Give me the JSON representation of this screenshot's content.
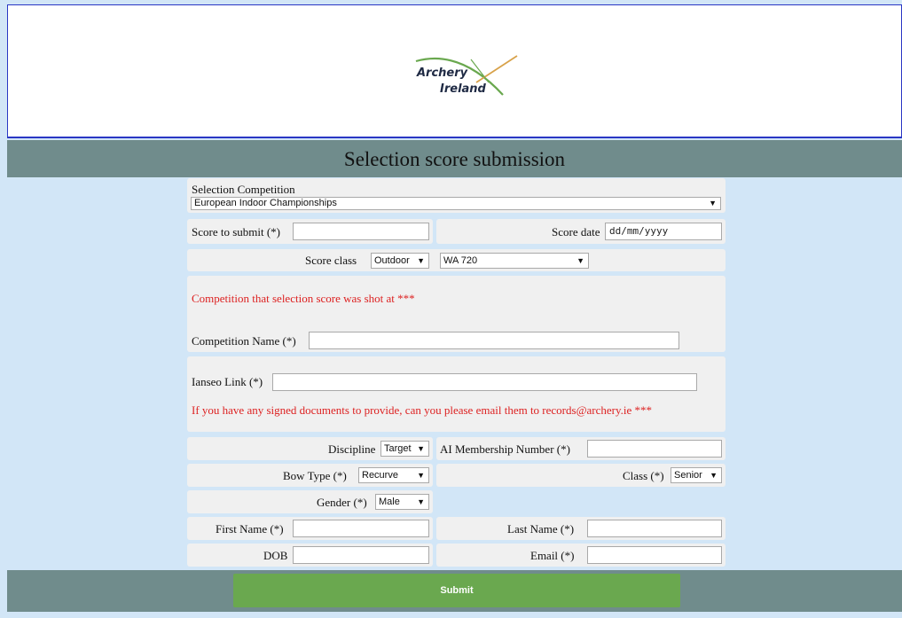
{
  "header": {
    "logo_line1": "Archery",
    "logo_line2": "Ireland"
  },
  "page_title": "Selection score submission",
  "form": {
    "selection_competition": {
      "label": "Selection Competition",
      "value": "European Indoor Championships"
    },
    "score_to_submit": {
      "label": "Score to submit (*)",
      "value": ""
    },
    "score_date": {
      "label": "Score date",
      "placeholder": "dd/mm/yyyy"
    },
    "score_class": {
      "label": "Score class",
      "value": "Outdoor",
      "round_value": "WA 720"
    },
    "competition_note": "Competition that selection score was shot at ***",
    "competition_name": {
      "label": "Competition Name (*)",
      "value": ""
    },
    "ianseo_link": {
      "label": "Ianseo Link (*)",
      "value": ""
    },
    "documents_note": "If you have any signed documents to provide, can you please email them to records@archery.ie ***",
    "discipline": {
      "label": "Discipline",
      "value": "Target"
    },
    "membership_number": {
      "label": "AI Membership Number (*)",
      "value": ""
    },
    "bow_type": {
      "label": "Bow Type (*)",
      "value": "Recurve"
    },
    "class": {
      "label": "Class (*)",
      "value": "Senior"
    },
    "gender": {
      "label": "Gender (*)",
      "value": "Male"
    },
    "first_name": {
      "label": "First Name (*)",
      "value": ""
    },
    "last_name": {
      "label": "Last Name (*)",
      "value": ""
    },
    "dob": {
      "label": "DOB",
      "value": ""
    },
    "email": {
      "label": "Email (*)",
      "value": ""
    }
  },
  "submit_label": "Submit",
  "colors": {
    "background": "#d2e6f7",
    "bar": "#708c8c",
    "submit": "#6aa84f",
    "note_red": "#dd2222",
    "border_blue": "#2a37c4"
  }
}
